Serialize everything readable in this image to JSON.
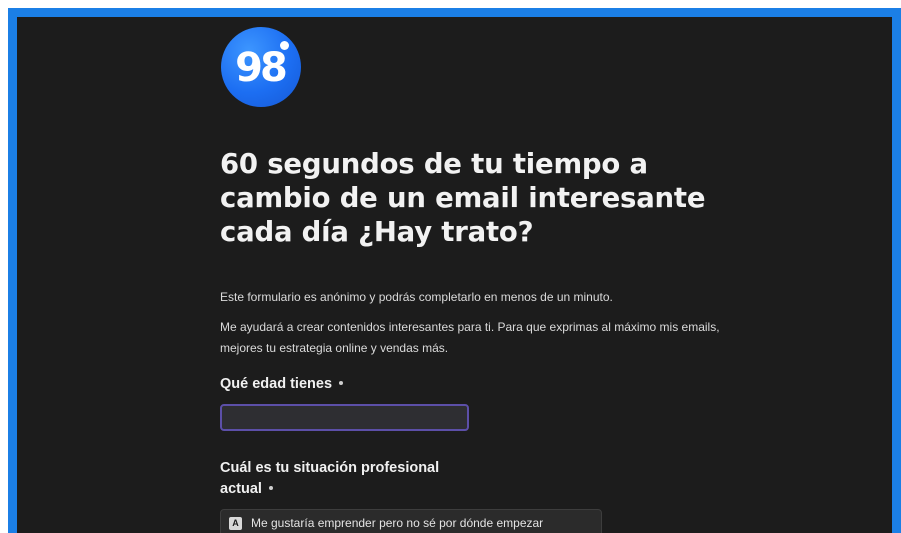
{
  "brand": {
    "logo_text": "98",
    "logo_color": "#1c6ef2"
  },
  "colors": {
    "frame": "#1b7fe6",
    "background": "#1c1c1c",
    "input_focus_border": "#5c4fa8"
  },
  "form": {
    "title": "60 segundos de tu tiempo a cambio de un email interesante cada día ¿Hay trato?",
    "intro_1": "Este formulario es anónimo y podrás completarlo en menos de un minuto.",
    "intro_2": "Me ayudará a crear contenidos interesantes para ti. Para que exprimas al máximo mis emails, mejores tu estrategia online y vendas más.",
    "questions": [
      {
        "label": "Qué edad tienes",
        "required": true,
        "value": "",
        "placeholder": ""
      },
      {
        "label": "Cuál es tu situación profesional actual",
        "required": true,
        "options": [
          {
            "key": "A",
            "label": "Me gustaría emprender pero no sé por dónde empezar"
          }
        ]
      }
    ]
  }
}
